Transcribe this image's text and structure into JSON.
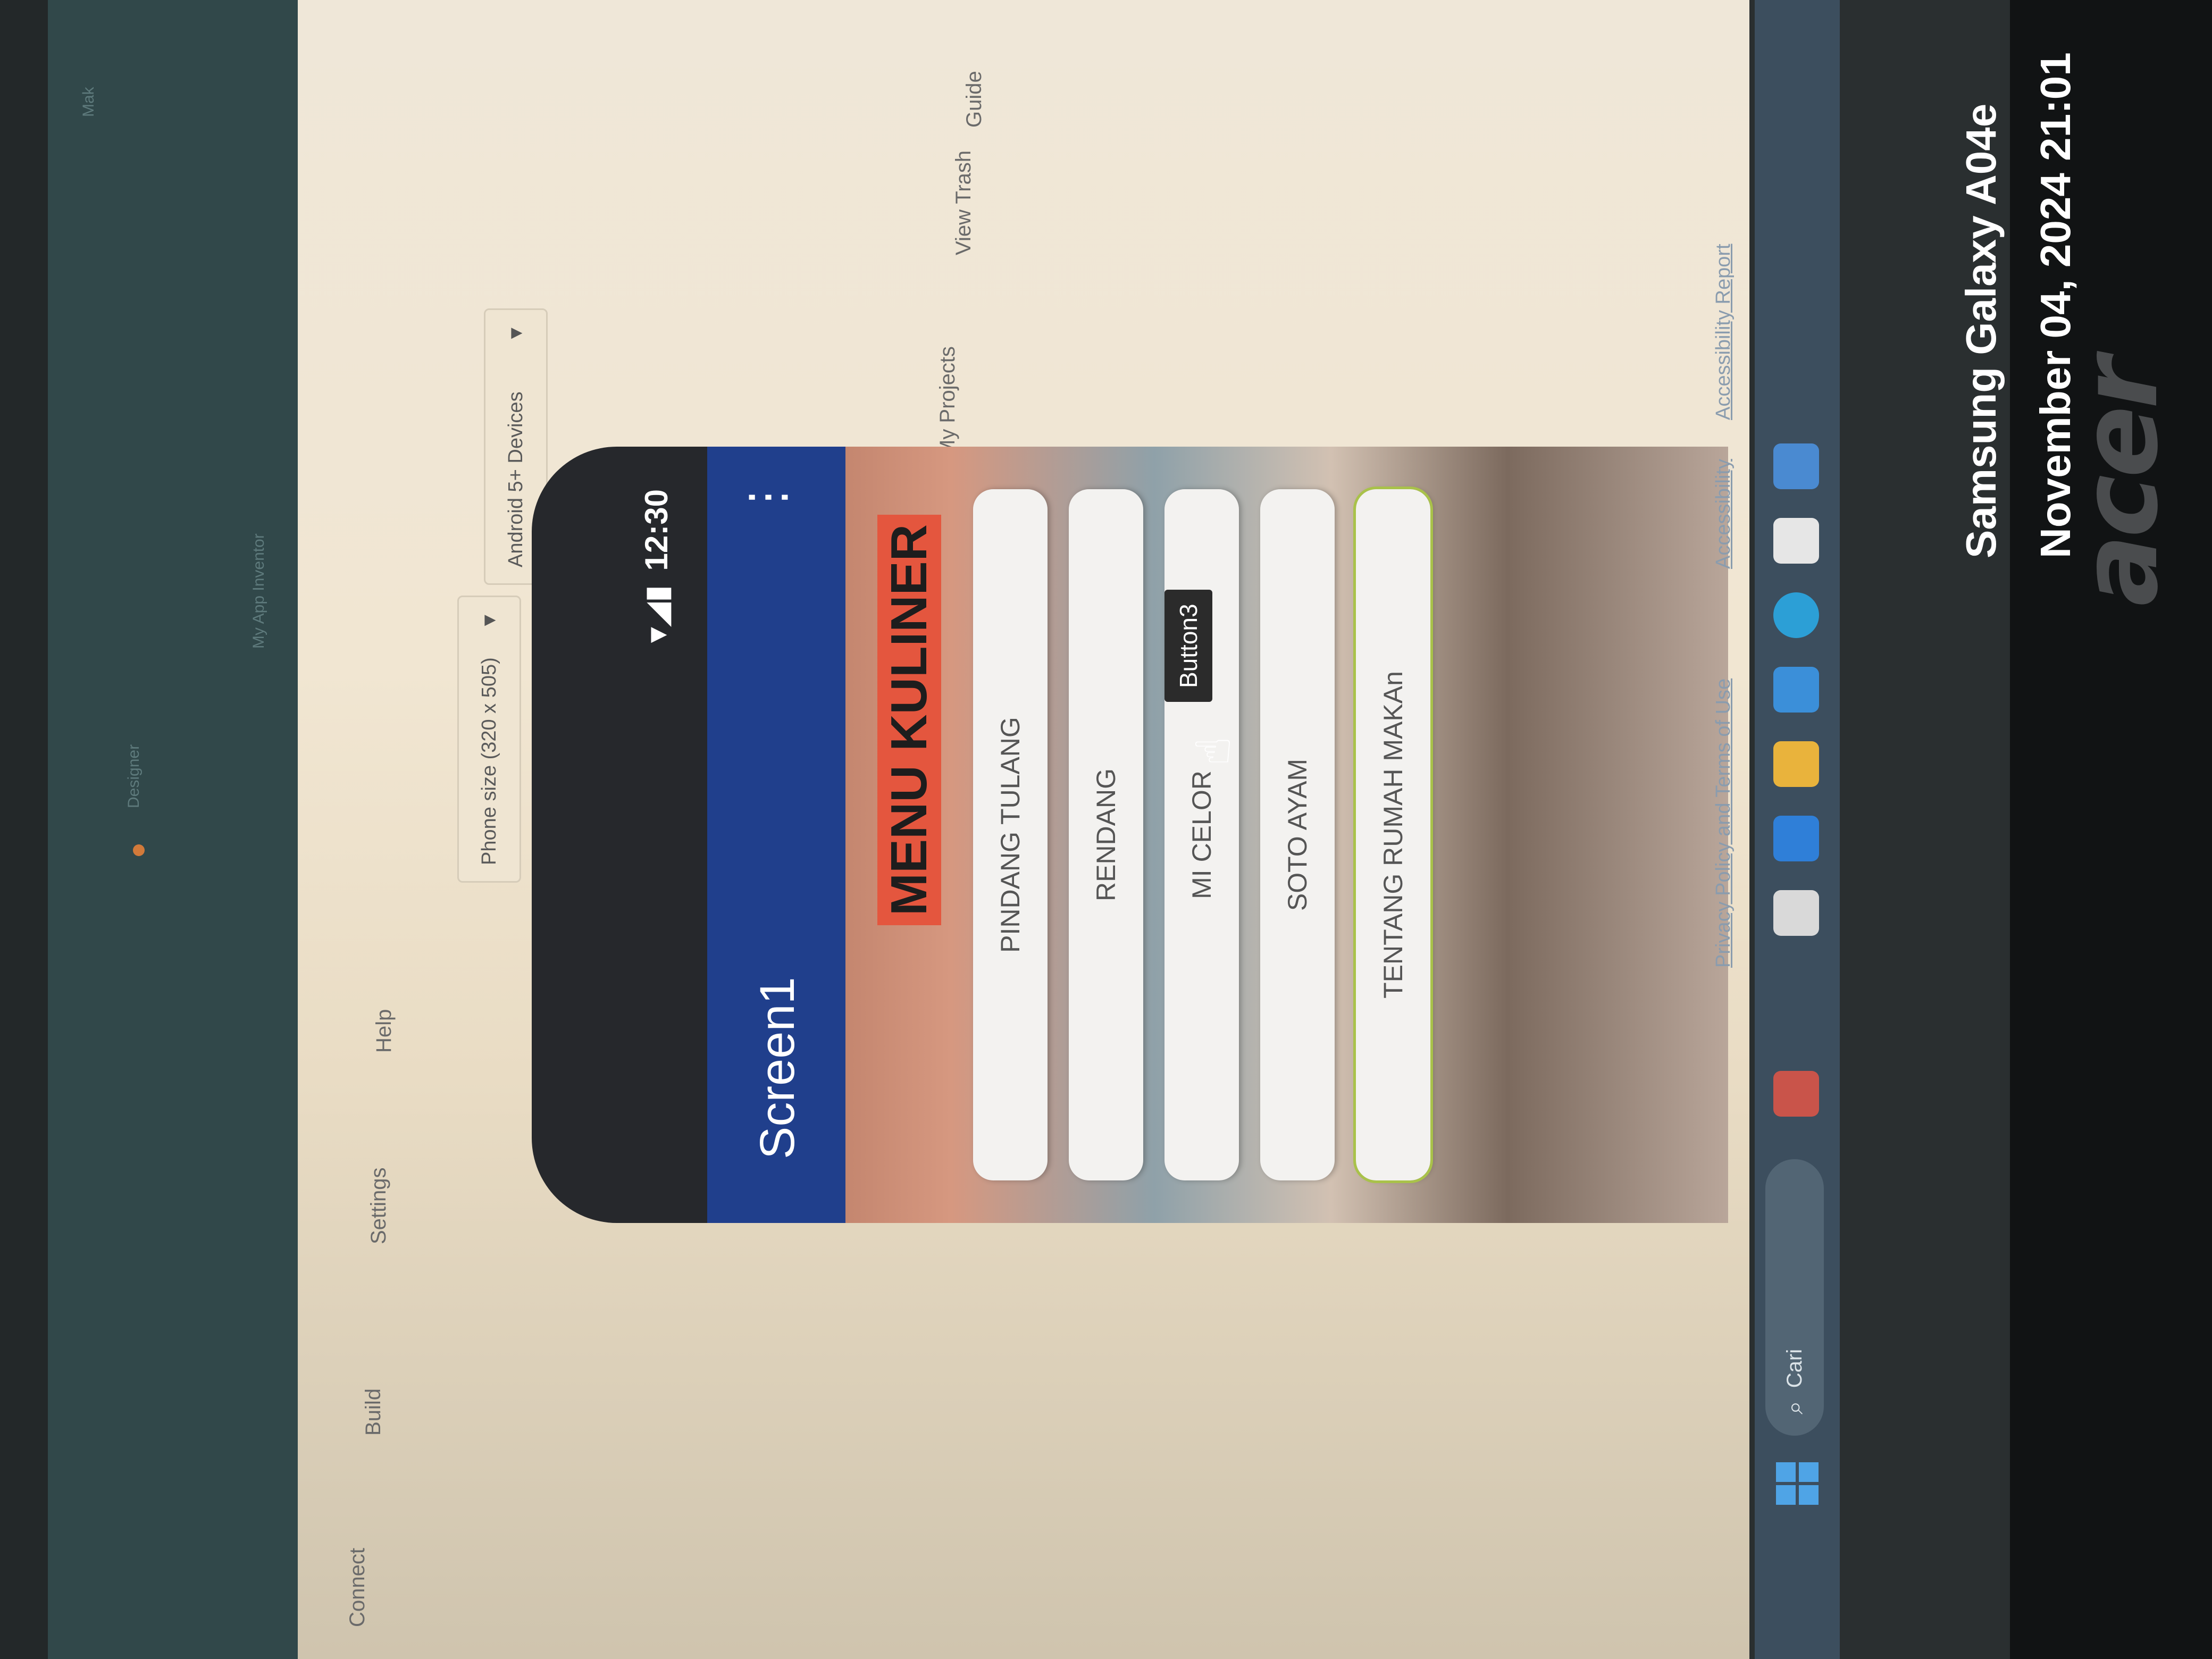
{
  "browser": {
    "tabs": [
      "Mak",
      "My App Inventor",
      "Designer"
    ]
  },
  "app_inventor": {
    "menu": [
      "Connect",
      "Build",
      "Settings",
      "Help"
    ],
    "nav_right": [
      "My Projects",
      "View Trash",
      "Guide"
    ],
    "phone_size_dropdown": "Phone size (320 x 505)",
    "android_dropdown": "Android 5+ Devices",
    "footer_links": [
      "Privacy Policy and Terms of Use",
      "Accessibility",
      "Accessibility Report"
    ]
  },
  "phone": {
    "status_time": "12:30",
    "screen_title": "Screen1",
    "menu_title": "MENU KULINER",
    "buttons": [
      "PINDANG TULANG",
      "RENDANG",
      "MI CELOR",
      "SOTO AYAM",
      "TENTANG RUMAH MAKAn"
    ],
    "tooltip": "Button3"
  },
  "taskbar": {
    "search_placeholder": "Cari"
  },
  "camera_watermark": {
    "device": "Samsung Galaxy A04e",
    "datetime": "November 04, 2024  21:01"
  },
  "brand": {
    "laptop_logo": "acer"
  },
  "colors": {
    "appbar": "#203f8c",
    "menu_title_bg": "#e4563e",
    "selected_outline": "#a9c24a"
  }
}
